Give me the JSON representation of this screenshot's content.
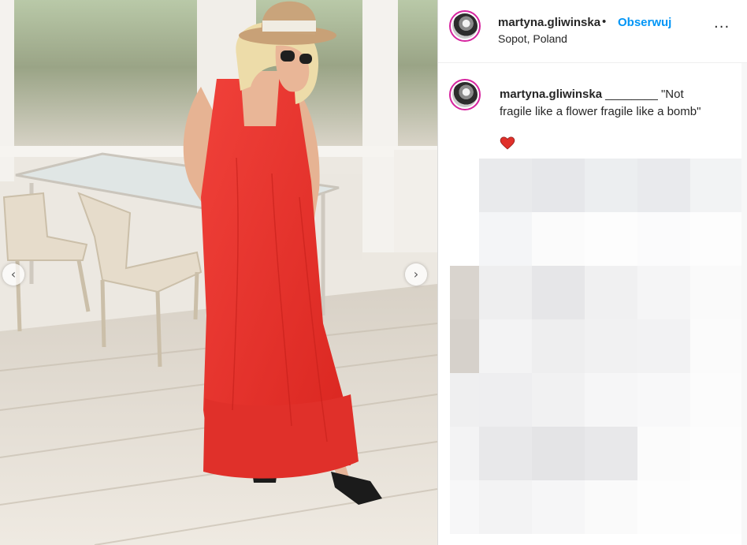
{
  "post": {
    "username": "martyna.gliwinska",
    "separator": "•",
    "follow_label": "Obserwuj",
    "location": "Sopot, Poland",
    "more_icon": "···",
    "caption_user": "martyna.gliwinska",
    "caption_text": "________ \"Not fragile like a flower fragile like a bomb\"",
    "emoji": "red-heart-icon"
  },
  "carousel": {
    "prev_icon": "‹",
    "next_icon": "›"
  },
  "colors": {
    "dress": "#e8302c",
    "follow": "#0095f6",
    "avatar_ring": "#d6249f"
  }
}
